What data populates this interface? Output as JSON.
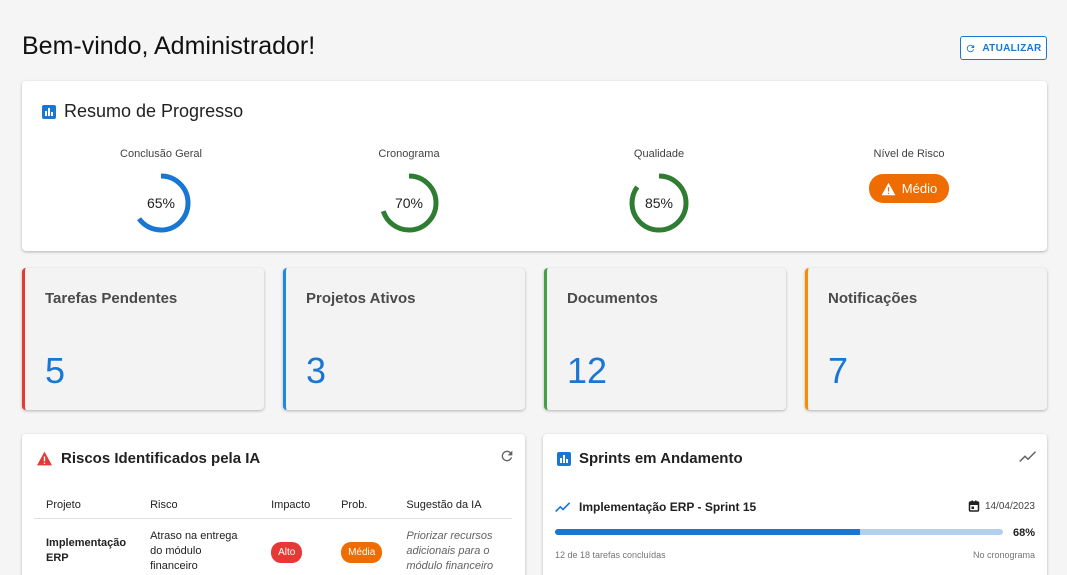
{
  "header": {
    "title": "Bem-vindo, Administrador!",
    "refresh_label": "ATUALIZAR"
  },
  "progress": {
    "title": "Resumo de Progresso",
    "metrics": [
      {
        "label": "Conclusão Geral",
        "value_text": "65%",
        "value": 65,
        "color": "#1976d2"
      },
      {
        "label": "Cronograma",
        "value_text": "70%",
        "value": 70,
        "color": "#2e7d32"
      },
      {
        "label": "Qualidade",
        "value_text": "85%",
        "value": 85,
        "color": "#2e7d32"
      }
    ],
    "risk": {
      "label": "Nível de Risco",
      "value": "Médio",
      "color": "#ef6c00"
    }
  },
  "stats": [
    {
      "title": "Tarefas Pendentes",
      "value": "5",
      "accent": "#e53935"
    },
    {
      "title": "Projetos Ativos",
      "value": "3",
      "accent": "#1e88e5"
    },
    {
      "title": "Documentos",
      "value": "12",
      "accent": "#43a047"
    },
    {
      "title": "Notificações",
      "value": "7",
      "accent": "#fb8c00"
    }
  ],
  "risks": {
    "title": "Riscos Identificados pela IA",
    "columns": [
      "Projeto",
      "Risco",
      "Impacto",
      "Prob.",
      "Sugestão da IA"
    ],
    "rows": [
      {
        "project": "Implementação ERP",
        "risk": "Atraso na entrega do módulo financeiro",
        "impact": "Alto",
        "impact_color": "#e53935",
        "probability": "Média",
        "probability_color": "#ef6c00",
        "suggestion": "Priorizar recursos adicionais para o módulo financeiro e"
      }
    ]
  },
  "sprints": {
    "title": "Sprints em Andamento",
    "items": [
      {
        "name": "Implementação ERP - Sprint 15",
        "date": "14/04/2023",
        "percent_text": "68%",
        "percent": 68,
        "tasks_text": "12 de 18 tarefas concluídas",
        "status": "No cronograma"
      }
    ]
  },
  "icons": {
    "refresh": "refresh-icon",
    "chart": "bar-chart-icon",
    "warning": "warning-icon",
    "trend": "trending-up-icon",
    "calendar": "calendar-icon"
  }
}
